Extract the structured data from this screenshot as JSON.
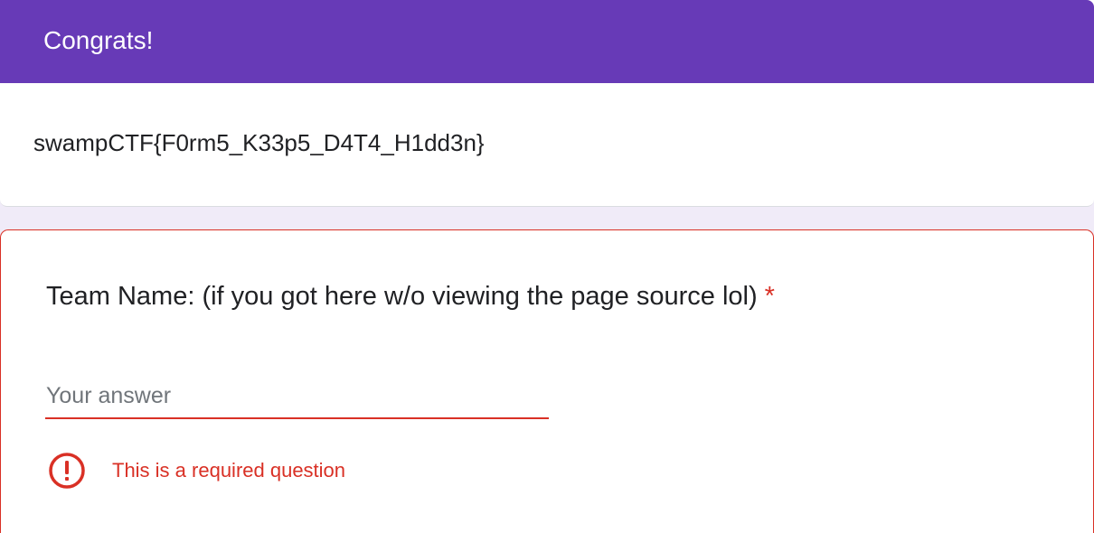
{
  "section": {
    "title": "Congrats!",
    "description": "swampCTF{F0rm5_K33p5_D4T4_H1dd3n}"
  },
  "question": {
    "title": "Team Name: (if you got here w/o viewing the page source lol)",
    "required_marker": "*",
    "input_placeholder": "Your answer",
    "input_value": "",
    "error_text": "This is a required question",
    "error_icon": "error-icon"
  },
  "colors": {
    "header": "#673ab7",
    "background": "#f0ebf8",
    "error": "#d93025",
    "text": "#202124"
  }
}
